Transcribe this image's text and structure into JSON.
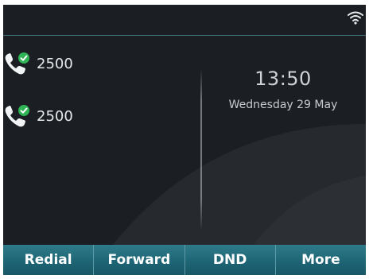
{
  "screen": {
    "colors": {
      "background": "#1b1f24",
      "accent": "#1e6575",
      "status_ok": "#2fb455"
    }
  },
  "status_bar": {
    "icons": [
      "wifi-icon"
    ]
  },
  "accounts": [
    {
      "label": "2500",
      "icon": "phone-handset-icon",
      "status": "registered",
      "status_icon": "check-badge-icon"
    },
    {
      "label": "2500",
      "icon": "phone-handset-icon",
      "status": "registered",
      "status_icon": "check-badge-icon"
    }
  ],
  "clock": {
    "time": "13:50",
    "date": "Wednesday  29 May"
  },
  "softkeys": [
    {
      "label": "Redial"
    },
    {
      "label": "Forward"
    },
    {
      "label": "DND"
    },
    {
      "label": "More"
    }
  ]
}
